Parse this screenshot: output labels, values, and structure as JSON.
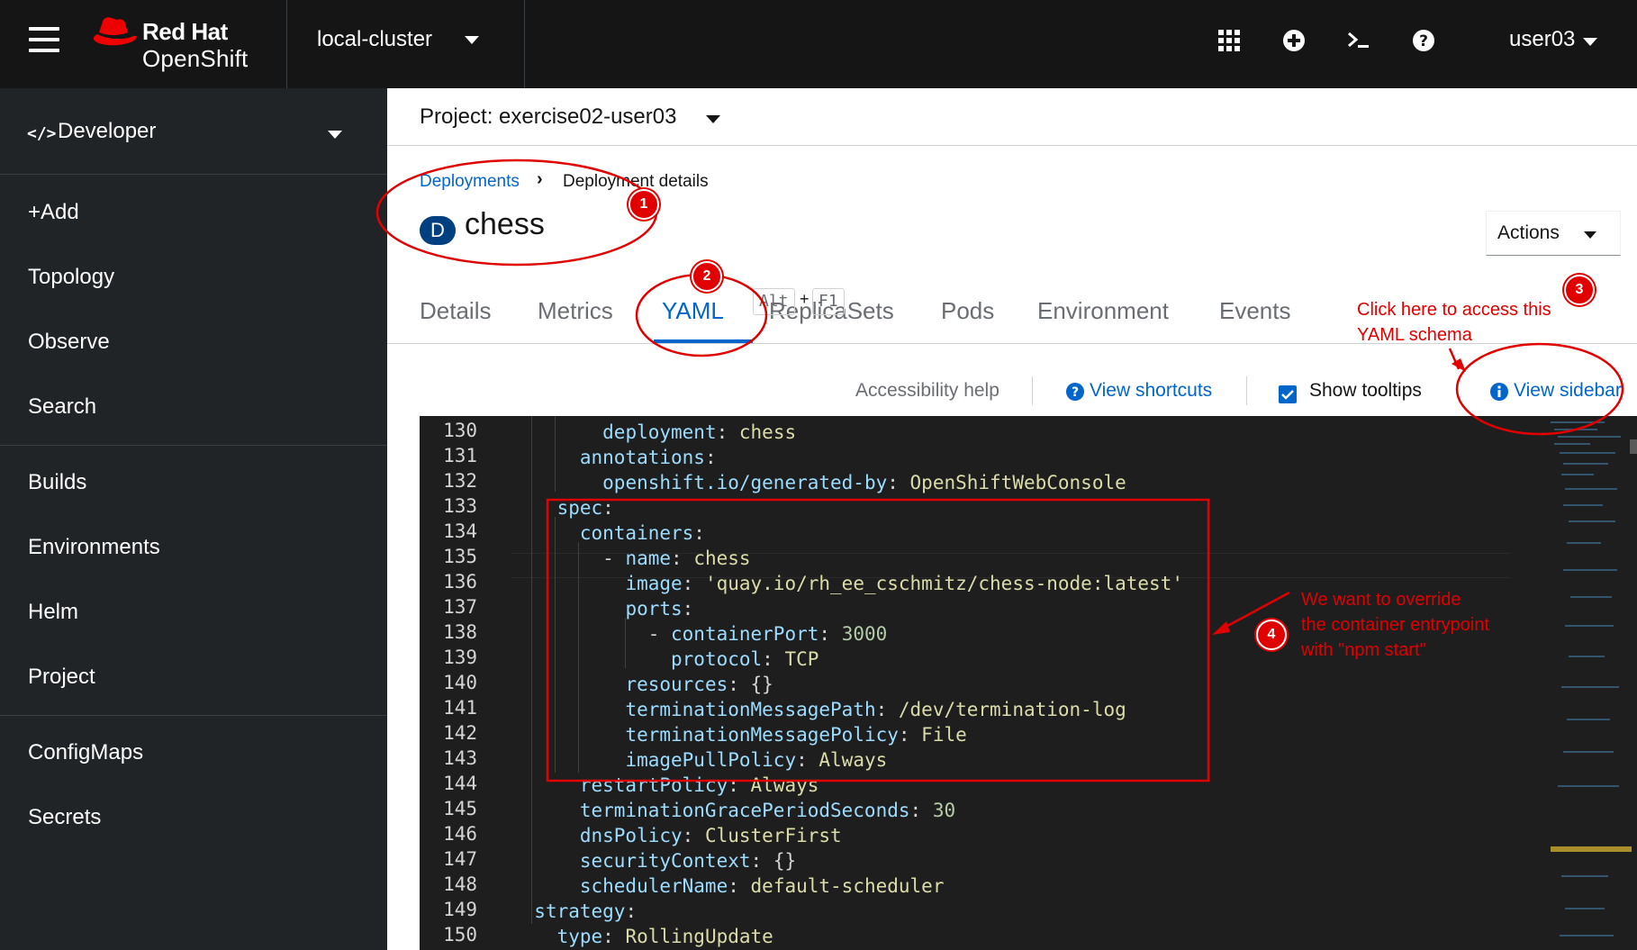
{
  "masthead": {
    "brand_line1": "Red Hat",
    "brand_line2": "OpenShift",
    "cluster": "local-cluster",
    "user": "user03"
  },
  "sidebar": {
    "perspective": "Developer",
    "items": [
      "+Add",
      "Topology",
      "Observe",
      "Search",
      "Builds",
      "Environments",
      "Helm",
      "Project",
      "ConfigMaps",
      "Secrets"
    ]
  },
  "project": {
    "label": "Project: exercise02-user03"
  },
  "breadcrumb": {
    "parent": "Deployments",
    "separator": "›",
    "current": "Deployment details"
  },
  "resource": {
    "badge": "D",
    "name": "chess",
    "actions_label": "Actions"
  },
  "tabs": [
    "Details",
    "Metrics",
    "YAML",
    "ReplicaSets",
    "Pods",
    "Environment",
    "Events"
  ],
  "active_tab": "YAML",
  "toolbar": {
    "key1": "Alt",
    "plus": "+",
    "key2": "F1",
    "accessibility": "Accessibility help",
    "shortcuts": "View shortcuts",
    "tooltips": "Show tooltips",
    "sidebar": "View sidebar"
  },
  "editor": {
    "lines": [
      {
        "no": "130",
        "text": "        deployment: chess"
      },
      {
        "no": "131",
        "text": "      annotations:"
      },
      {
        "no": "132",
        "text": "        openshift.io/generated-by: OpenShiftWebConsole"
      },
      {
        "no": "133",
        "text": "    spec:"
      },
      {
        "no": "134",
        "text": "      containers:"
      },
      {
        "no": "135",
        "text": "        - name: chess"
      },
      {
        "no": "136",
        "text": "          image: 'quay.io/rh_ee_cschmitz/chess-node:latest'"
      },
      {
        "no": "137",
        "text": "          ports:"
      },
      {
        "no": "138",
        "text": "            - containerPort: 3000"
      },
      {
        "no": "139",
        "text": "              protocol: TCP"
      },
      {
        "no": "140",
        "text": "          resources: {}"
      },
      {
        "no": "141",
        "text": "          terminationMessagePath: /dev/termination-log"
      },
      {
        "no": "142",
        "text": "          terminationMessagePolicy: File"
      },
      {
        "no": "143",
        "text": "          imagePullPolicy: Always"
      },
      {
        "no": "144",
        "text": "      restartPolicy: Always"
      },
      {
        "no": "145",
        "text": "      terminationGracePeriodSeconds: 30"
      },
      {
        "no": "146",
        "text": "      dnsPolicy: ClusterFirst"
      },
      {
        "no": "147",
        "text": "      securityContext: {}"
      },
      {
        "no": "148",
        "text": "      schedulerName: default-scheduler"
      },
      {
        "no": "149",
        "text": "  strategy:"
      },
      {
        "no": "150",
        "text": "    type: RollingUpdate"
      }
    ]
  },
  "annotations": {
    "m1": "1",
    "m2": "2",
    "m3": "3",
    "m4": "4",
    "note3_line1": "Click here to access this",
    "note3_line2": "YAML schema",
    "note4_line1": "We want to override",
    "note4_line2": "the container entrypoint",
    "note4_line3": "with \"npm start\""
  },
  "colors": {
    "masthead": "#151515",
    "sidebar": "#212427",
    "link": "#0066cc",
    "annotation": "#e00000",
    "editor_bg": "#1e1e1e"
  }
}
